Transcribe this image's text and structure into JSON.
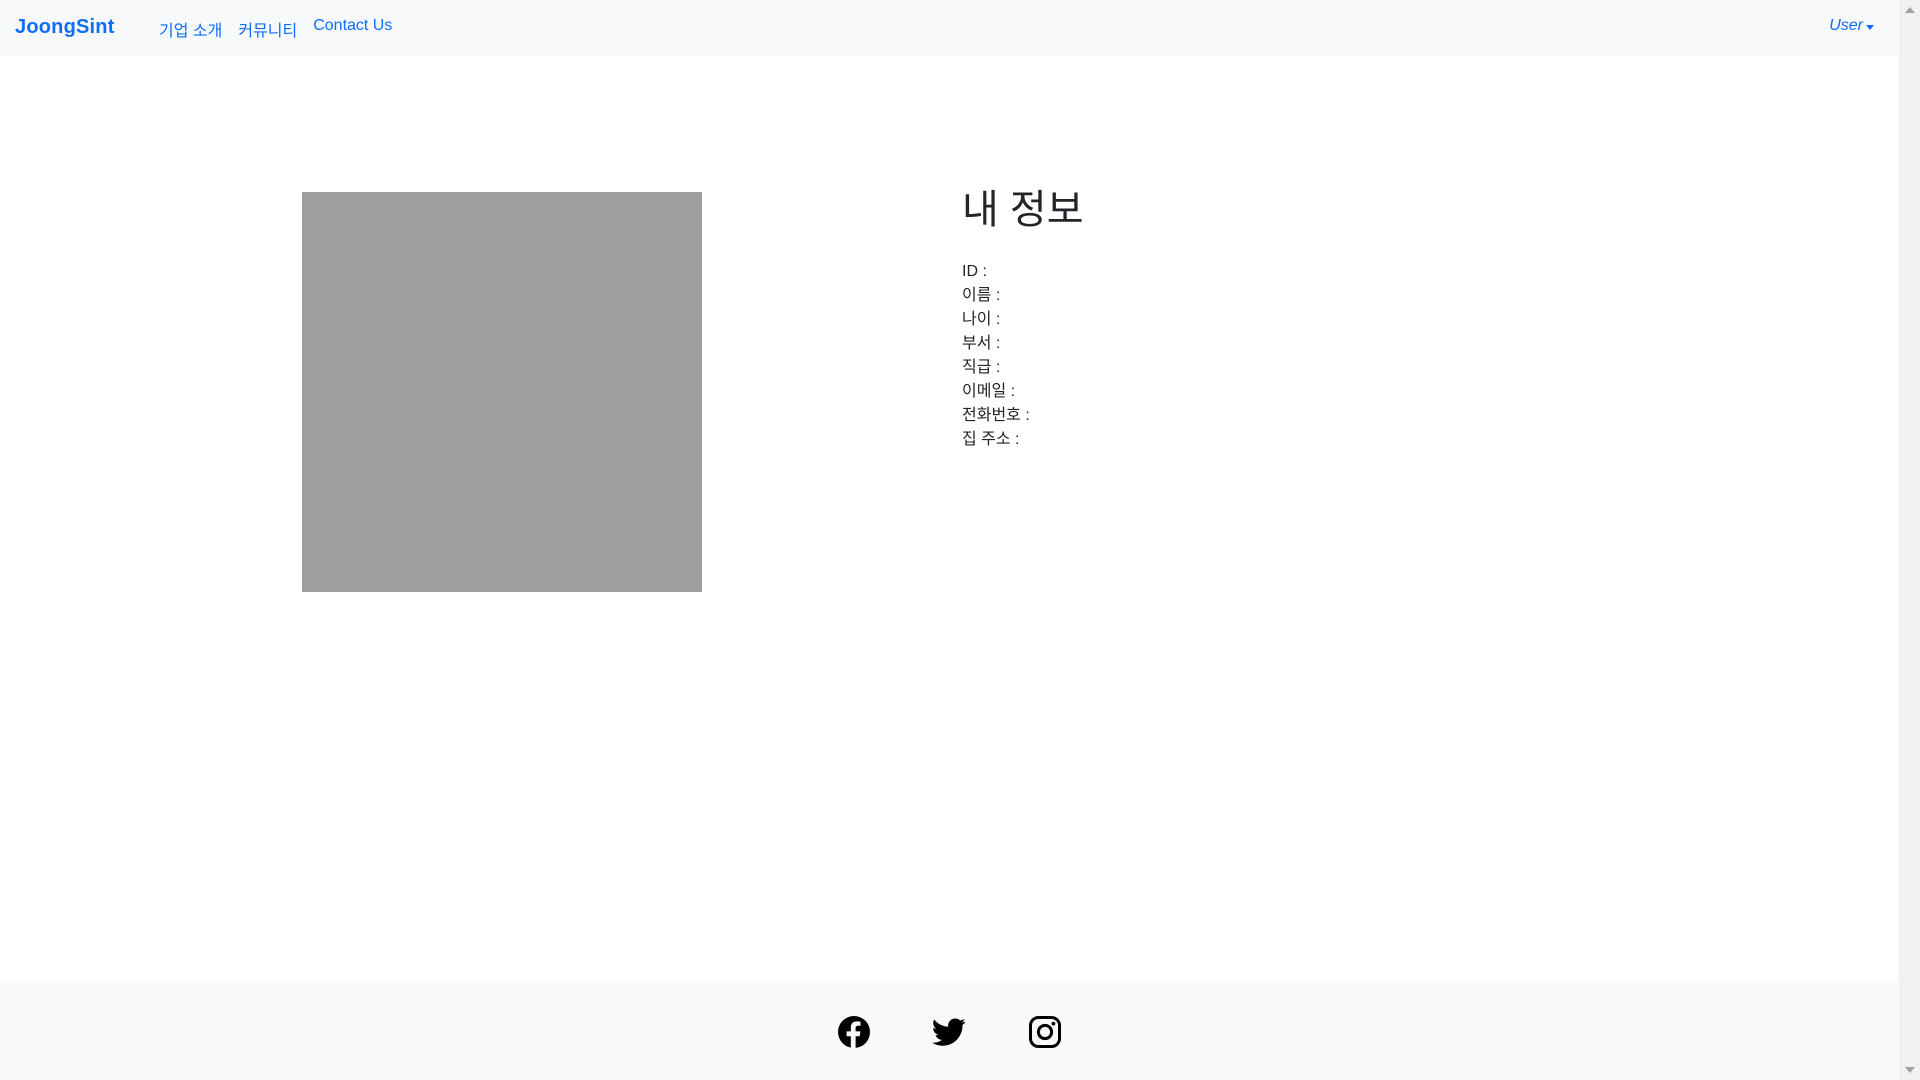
{
  "navbar": {
    "brand": "JoongSint",
    "links": [
      {
        "label": "기업 소개"
      },
      {
        "label": "커뮤니티"
      },
      {
        "label": "Contact Us"
      }
    ],
    "user_menu": "User"
  },
  "profile": {
    "title": "내 정보",
    "fields": [
      {
        "label": "ID :"
      },
      {
        "label": "이름 :"
      },
      {
        "label": "나이 :"
      },
      {
        "label": "부서 :"
      },
      {
        "label": "직급 :"
      },
      {
        "label": "이메일 :"
      },
      {
        "label": "전화번호 :"
      },
      {
        "label": "집 주소 :"
      }
    ]
  },
  "footer": {
    "icons": [
      "facebook-icon",
      "twitter-icon",
      "instagram-icon"
    ]
  },
  "colors": {
    "accent": "#0d6efd",
    "navbar_bg": "#f8f9fa",
    "image_placeholder": "#9e9e9e",
    "text": "#212529"
  }
}
